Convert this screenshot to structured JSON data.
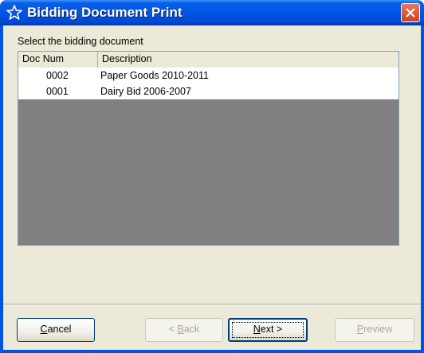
{
  "window": {
    "title": "Bidding Document Print",
    "title_icon": "star-outline-icon",
    "close_icon": "close-icon"
  },
  "prompt_label": "Select the bidding document",
  "listview": {
    "columns": [
      "Doc Num",
      "Description"
    ],
    "rows": [
      {
        "doc_num": "0002",
        "description": "Paper Goods 2010-2011"
      },
      {
        "doc_num": "0001",
        "description": "Dairy Bid 2006-2007"
      }
    ]
  },
  "buttons": {
    "cancel": {
      "before": "",
      "mnemonic": "C",
      "after": "ancel",
      "enabled": true
    },
    "back": {
      "before": "< ",
      "mnemonic": "B",
      "after": "ack",
      "enabled": false
    },
    "next": {
      "before": "",
      "mnemonic": "N",
      "after": "ext >",
      "enabled": true,
      "default": true
    },
    "preview": {
      "before": "",
      "mnemonic": "P",
      "after": "review",
      "enabled": false
    }
  },
  "colors": {
    "titlebar": "#0055e5",
    "client": "#ece9d8",
    "list_empty": "#808080",
    "close_button": "#d55a36"
  }
}
